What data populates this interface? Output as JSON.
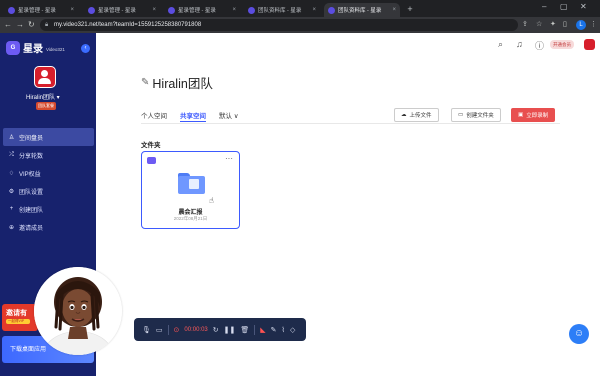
{
  "browser": {
    "tabs": [
      {
        "label": "星录管理 - 星录"
      },
      {
        "label": "星录管理 - 星录"
      },
      {
        "label": "星录管理 - 星录"
      },
      {
        "label": "团队资料库 - 星录"
      },
      {
        "label": "团队资料库 - 星录"
      }
    ],
    "url": "my.video321.net/team?teamId=1559125258380791808",
    "profile_initial": "L"
  },
  "sidebar": {
    "brand": "星录",
    "brand_sub": "Video321",
    "team_name": "Hiralin团队 ▾",
    "team_badge": "团队套餐",
    "menu": [
      {
        "icon": "person-icon",
        "glyph": "♙",
        "label": "空间盘员"
      },
      {
        "icon": "share-icon",
        "glyph": "⤮",
        "label": "分享轮数"
      },
      {
        "icon": "vip-icon",
        "glyph": "♢",
        "label": "VIP权益"
      },
      {
        "icon": "settings-icon",
        "glyph": "⚙",
        "label": "团队设置"
      },
      {
        "icon": "add-team-icon",
        "glyph": "+",
        "label": "创建团队"
      },
      {
        "icon": "invite-icon",
        "glyph": "⊕",
        "label": "邀请成员"
      }
    ],
    "promo_invite": "邀请有",
    "promo_invite_tag": "一起得VIP",
    "promo_download": "下载桌面应用"
  },
  "header": {
    "vip_badge": "开通会员"
  },
  "main": {
    "title": "Hiralin团队",
    "tabs": [
      {
        "label": "个人空间"
      },
      {
        "label": "共享空间"
      },
      {
        "label": "默认 ∨"
      }
    ],
    "actions": {
      "upload": "上传文件",
      "new_folder": "创建文件夹",
      "record": "立即录制"
    },
    "section_title": "文件夹",
    "folder": {
      "name": "晨会汇报",
      "date": "2022年08月21日"
    }
  },
  "recorder": {
    "time": "00:00:03"
  },
  "colors": {
    "sidebar_bg": "#17226d",
    "accent": "#3d5afe",
    "record_button": "#e84f4f",
    "recorder_bg": "#1e2b4b"
  }
}
